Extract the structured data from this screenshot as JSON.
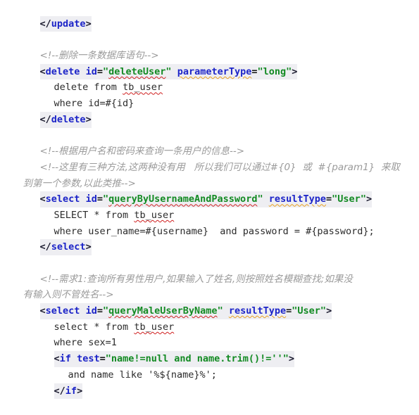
{
  "editor": {
    "language": "xml",
    "file_kind": "MyBatis mapper XML",
    "colors": {
      "background": "#ffffff",
      "tag_name": "#1c24c8",
      "attribute_name": "#1c24c8",
      "attribute_value": "#128a22",
      "comment": "#9b9b9b",
      "plain_text": "#2b2b2b",
      "punctuation": "#1a1a2e",
      "tag_line_highlight": "#eeeef2",
      "spellcheck_underline_red": "#d02020",
      "warning_underline_orange": "#e8a020"
    }
  },
  "lines": [
    {
      "id": "l01",
      "indent": 1,
      "type": "tag",
      "text": "</update>"
    },
    {
      "id": "l02",
      "indent": 0,
      "type": "blank",
      "text": ""
    },
    {
      "id": "l03",
      "indent": 1,
      "type": "comment",
      "text": "<!--删除一条数据库语句-->"
    },
    {
      "id": "l04",
      "indent": 1,
      "type": "tag",
      "text": "<delete id=\"deleteUser\" parameterType=\"long\">"
    },
    {
      "id": "l05",
      "indent": 2,
      "type": "sql",
      "text": "delete from tb_user"
    },
    {
      "id": "l06",
      "indent": 2,
      "type": "sql",
      "text": "where id=#{id}"
    },
    {
      "id": "l07",
      "indent": 1,
      "type": "tag",
      "text": "</delete>"
    },
    {
      "id": "l08",
      "indent": 0,
      "type": "blank",
      "text": ""
    },
    {
      "id": "l09",
      "indent": 1,
      "type": "comment",
      "text": "<!--根据用户名和密码来查询一条用户的信息-->"
    },
    {
      "id": "l10",
      "indent": 1,
      "type": "comment",
      "text": "<!--这里有三种方法,这两种没有用   所以我们可以通过#{0}  或  #{param1}  来取"
    },
    {
      "id": "l11",
      "indent": 0,
      "type": "comment",
      "text": "到第一个参数,以此类推-->"
    },
    {
      "id": "l12",
      "indent": 1,
      "type": "tag",
      "text": "<select id=\"queryByUsernameAndPassword\" resultType=\"User\">"
    },
    {
      "id": "l13",
      "indent": 2,
      "type": "sql",
      "text": "SELECT * from tb_user"
    },
    {
      "id": "l14",
      "indent": 2,
      "type": "sql",
      "text": "where user_name=#{username} and password = #{password};"
    },
    {
      "id": "l15",
      "indent": 1,
      "type": "tag",
      "text": "</select>"
    },
    {
      "id": "l16",
      "indent": 0,
      "type": "blank",
      "text": ""
    },
    {
      "id": "l17",
      "indent": 1,
      "type": "comment",
      "text": "<!--需求1:查询所有男性用户,如果输入了姓名,则按照姓名模糊查找;如果没"
    },
    {
      "id": "l18",
      "indent": 0,
      "type": "comment",
      "text": "有输入则不管姓名-->"
    },
    {
      "id": "l19",
      "indent": 1,
      "type": "tag",
      "text": "<select id=\"queryMaleUserByName\" resultType=\"User\">"
    },
    {
      "id": "l20",
      "indent": 2,
      "type": "sql",
      "text": "select * from tb_user"
    },
    {
      "id": "l21",
      "indent": 2,
      "type": "sql",
      "text": "where sex=1"
    },
    {
      "id": "l22",
      "indent": 2,
      "type": "tag",
      "text": "<if test=\"name!=null and name.trim()!=''\">"
    },
    {
      "id": "l23",
      "indent": 3,
      "type": "sql",
      "text": "and name like '%${name}%';"
    },
    {
      "id": "l24",
      "indent": 2,
      "type": "tag",
      "text": "</if>"
    }
  ],
  "tokens": {
    "l01": {
      "lt": "<",
      "slash": "/",
      "tag": "update",
      "gt": ">"
    },
    "l04": {
      "lt": "<",
      "tag": "delete",
      "sp": " ",
      "attr1": "id",
      "eq1": "=",
      "q1a": "\"",
      "val1": "deleteUser",
      "q1b": "\"",
      "attr2": "parameterType",
      "eq2": "=",
      "q2a": "\"",
      "val2": "long",
      "q2b": "\"",
      "gt": ">"
    },
    "l07": {
      "lt": "<",
      "slash": "/",
      "tag": "delete",
      "gt": ">"
    },
    "l12": {
      "lt": "<",
      "tag": "select",
      "sp": " ",
      "attr1": "id",
      "eq1": "=",
      "q1a": "\"",
      "val1": "queryByUsernameAndPassword",
      "q1b": "\"",
      "attr2": "resultType",
      "eq2": "=",
      "q2a": "\"",
      "val2": "User",
      "q2b": "\"",
      "gt": ">"
    },
    "l15": {
      "lt": "<",
      "slash": "/",
      "tag": "select",
      "gt": ">"
    },
    "l19": {
      "lt": "<",
      "tag": "select",
      "sp": " ",
      "attr1": "id",
      "eq1": "=",
      "q1a": "\"",
      "val1": "queryMaleUserByName",
      "q1b": "\"",
      "attr2": "resultType",
      "eq2": "=",
      "q2a": "\"",
      "val2": "User",
      "q2b": "\"",
      "gt": ">"
    },
    "l22": {
      "lt": "<",
      "tag": "if",
      "sp": " ",
      "attr1": "test",
      "eq1": "=",
      "q1a": "\"",
      "val1": "name!=null and name.trim()!=''",
      "q1b": "\"",
      "gt": ">"
    },
    "l24": {
      "lt": "<",
      "slash": "/",
      "tag": "if",
      "gt": ">"
    }
  },
  "sql_text": {
    "l05_pre": "delete from ",
    "l05_table": "tb_user",
    "l05_post": "",
    "l06": "where id=#{id}",
    "l13_pre": "SELECT * from ",
    "l13_table": "tb_user",
    "l13_post": "",
    "l14": "where user_name=#{username}  and password = #{password};",
    "l20_pre": "select * from ",
    "l20_table": "tb_user",
    "l20_post": "",
    "l21": "where sex=1",
    "l23": "and name like '%${name}%';"
  },
  "comments": {
    "l03": "<!--删除一条数据库语句-->",
    "l09": "<!--根据用户名和密码来查询一条用户的信息-->",
    "l10": "<!--这里有三种方法,这两种没有用   所以我们可以通过#{0}  或  #{param1}  来取",
    "l11": "到第一个参数,以此类推-->",
    "l17": "<!--需求1:查询所有男性用户,如果输入了姓名,则按照姓名模糊查找;如果没",
    "l18": "有输入则不管姓名-->"
  }
}
